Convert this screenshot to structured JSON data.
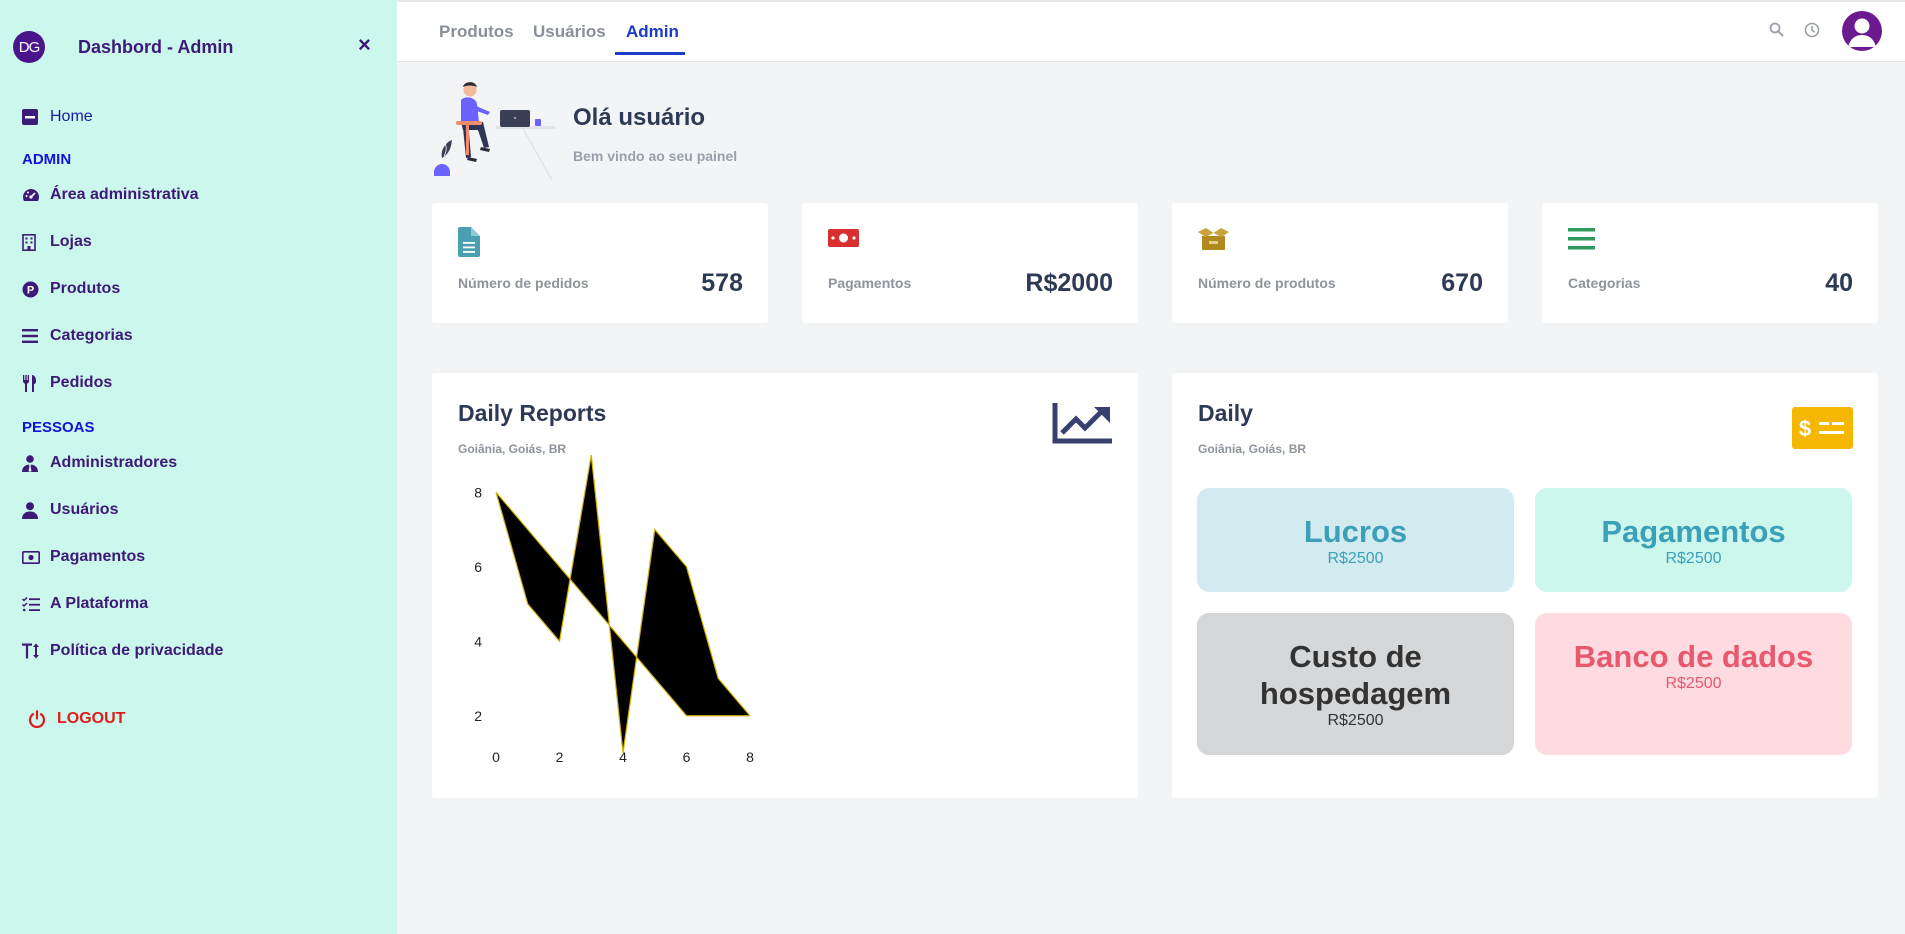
{
  "sidebar": {
    "logo_text": "DG",
    "title": "Dashbord - Admin",
    "close_symbol": "×",
    "home": "Home",
    "section_admin": "ADMIN",
    "admin_items": [
      "Área administrativa",
      "Lojas",
      "Produtos",
      "Categorias",
      "Pedidos"
    ],
    "section_people": "PESSOAS",
    "people_items": [
      "Administradores",
      "Usuários",
      "Pagamentos",
      "A Plataforma",
      "Política de privacidade"
    ],
    "logout": "LOGOUT"
  },
  "topbar": {
    "tabs": [
      "Produtos",
      "Usuários",
      "Admin"
    ],
    "active_tab": "Admin"
  },
  "greeting": {
    "title": "Olá usuário",
    "subtitle": "Bem vindo ao seu painel"
  },
  "stats": [
    {
      "label": "Número de pedidos",
      "value": "578",
      "icon": "file-document-icon",
      "color": "#4a9fb0"
    },
    {
      "label": "Pagamentos",
      "value": "R$2000",
      "icon": "money-bill-icon",
      "color": "#d9302f"
    },
    {
      "label": "Número de produtos",
      "value": "670",
      "icon": "open-box-icon",
      "color": "#b08a1f"
    },
    {
      "label": "Categorias",
      "value": "40",
      "icon": "list-icon",
      "color": "#2e9a5e"
    }
  ],
  "daily_reports": {
    "title": "Daily Reports",
    "subtitle": "Goiânia, Goiás, BR",
    "icon": "trend-up-icon"
  },
  "daily": {
    "title": "Daily",
    "subtitle": "Goiânia, Goiás, BR",
    "icon": "dollar-card-icon",
    "tiles": [
      {
        "title": "Lucros",
        "value": "R$2500",
        "bg": "#d1ebf0",
        "color": "#3ca0b8",
        "subcolor": "#3ca0b8"
      },
      {
        "title": "Pagamentos",
        "value": "R$2500",
        "bg": "#ccf7ec",
        "color": "#3ca0b8",
        "subcolor": "#3ca0b8"
      },
      {
        "title": "Custo de hospedagem",
        "value": "R$2500",
        "bg": "#d6d7d9",
        "color": "#333333",
        "subcolor": "#333333"
      },
      {
        "title": "Banco de dados",
        "value": "R$2500",
        "bg": "#fddbe0",
        "color": "#e8586e",
        "subcolor": "#e8586e"
      }
    ]
  },
  "chart_data": {
    "type": "area",
    "x": [
      0,
      1,
      2,
      3,
      4,
      5,
      6,
      7,
      8
    ],
    "series": [
      {
        "values": [
          8,
          5,
          4,
          9,
          1,
          7,
          6,
          3,
          2
        ]
      },
      {
        "values": [
          8,
          7,
          6,
          5,
          4,
          3,
          2,
          2,
          2
        ]
      }
    ],
    "x_ticks": [
      "0",
      "2",
      "4",
      "6",
      "8"
    ],
    "y_ticks": [
      "2",
      "4",
      "6",
      "8"
    ],
    "xlim": [
      0,
      8
    ],
    "ylim": [
      1,
      9
    ],
    "fill": "#000000",
    "stroke": "#d4b000",
    "grid": false
  }
}
